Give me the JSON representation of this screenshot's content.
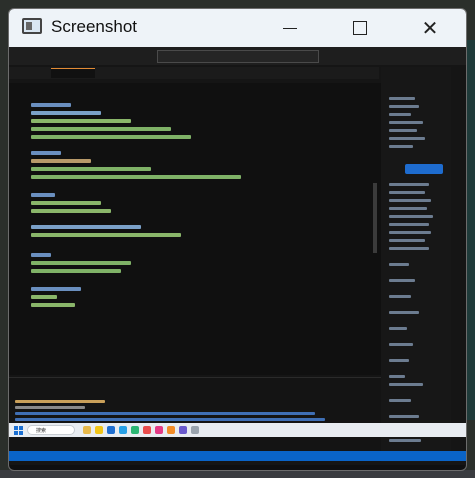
{
  "window": {
    "title": "Screenshot"
  },
  "taskbar": {
    "search_label": "搜索"
  },
  "colors": {
    "accent": "#0a64c8",
    "tab_active": "#e28b35",
    "editor_bg": "#101010"
  },
  "icons": [
    "app-window-icon",
    "minimize-icon",
    "maximize-icon",
    "close-icon",
    "start-icon"
  ]
}
